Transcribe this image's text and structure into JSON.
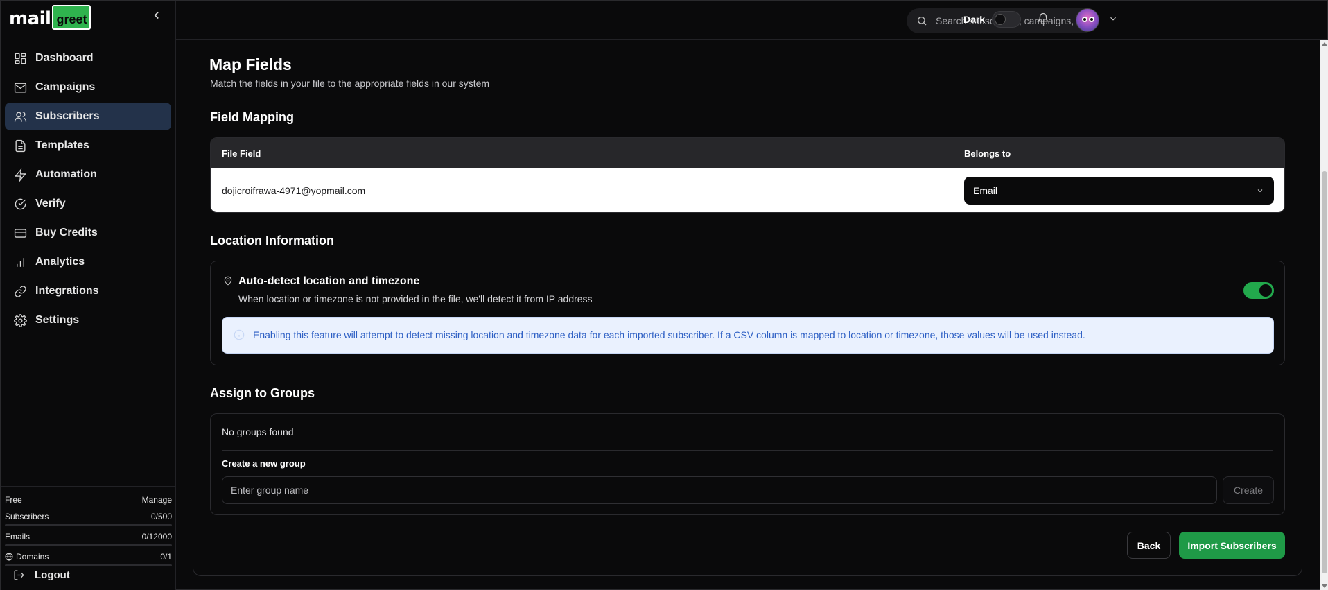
{
  "app": {
    "logo_main": "mail",
    "logo_badge": "greet"
  },
  "sidebar": {
    "items": [
      {
        "label": "Dashboard",
        "icon": "dashboard-icon",
        "active": false
      },
      {
        "label": "Campaigns",
        "icon": "mail-icon",
        "active": false
      },
      {
        "label": "Subscribers",
        "icon": "users-icon",
        "active": true
      },
      {
        "label": "Templates",
        "icon": "document-icon",
        "active": false
      },
      {
        "label": "Automation",
        "icon": "lightning-icon",
        "active": false
      },
      {
        "label": "Verify",
        "icon": "check-circle-icon",
        "active": false
      },
      {
        "label": "Buy Credits",
        "icon": "credit-card-icon",
        "active": false
      },
      {
        "label": "Analytics",
        "icon": "bar-chart-icon",
        "active": false
      },
      {
        "label": "Integrations",
        "icon": "link-icon",
        "active": false
      },
      {
        "label": "Settings",
        "icon": "gear-icon",
        "active": false
      }
    ],
    "plan": {
      "name": "Free",
      "manage": "Manage",
      "subscribers_label": "Subscribers",
      "subscribers_value": "0/500",
      "emails_label": "Emails",
      "emails_value": "0/12000",
      "domains_label": "Domains",
      "domains_value": "0/1"
    },
    "logout": "Logout"
  },
  "header": {
    "search_placeholder": "Search subscribers, campaigns, templates...",
    "theme_label": "Dark",
    "theme_dark_enabled": false
  },
  "page": {
    "title": "Map Fields",
    "subtitle": "Match the fields in your file to the appropriate fields in our system"
  },
  "field_mapping": {
    "title": "Field Mapping",
    "col_file_field": "File Field",
    "col_belongs_to": "Belongs to",
    "rows": [
      {
        "file_field": "dojicroifrawa-4971@yopmail.com",
        "belongs_to": "Email"
      }
    ]
  },
  "location": {
    "title": "Location Information",
    "option_title": "Auto-detect location and timezone",
    "option_desc": "When location or timezone is not provided in the file, we'll detect it from IP address",
    "enabled": true,
    "info": "Enabling this feature will attempt to detect missing location and timezone data for each imported subscriber. If a CSV column is mapped to location or timezone, those values will be used instead."
  },
  "groups": {
    "title": "Assign to Groups",
    "empty_text": "No groups found",
    "create_label": "Create a new group",
    "input_placeholder": "Enter group name",
    "create_button": "Create"
  },
  "actions": {
    "back": "Back",
    "import": "Import Subscribers"
  },
  "colors": {
    "accent_green": "#1f9a47",
    "active_nav": "#23324a",
    "info_bg": "#eaf1fe",
    "info_text": "#2d5fc4"
  }
}
